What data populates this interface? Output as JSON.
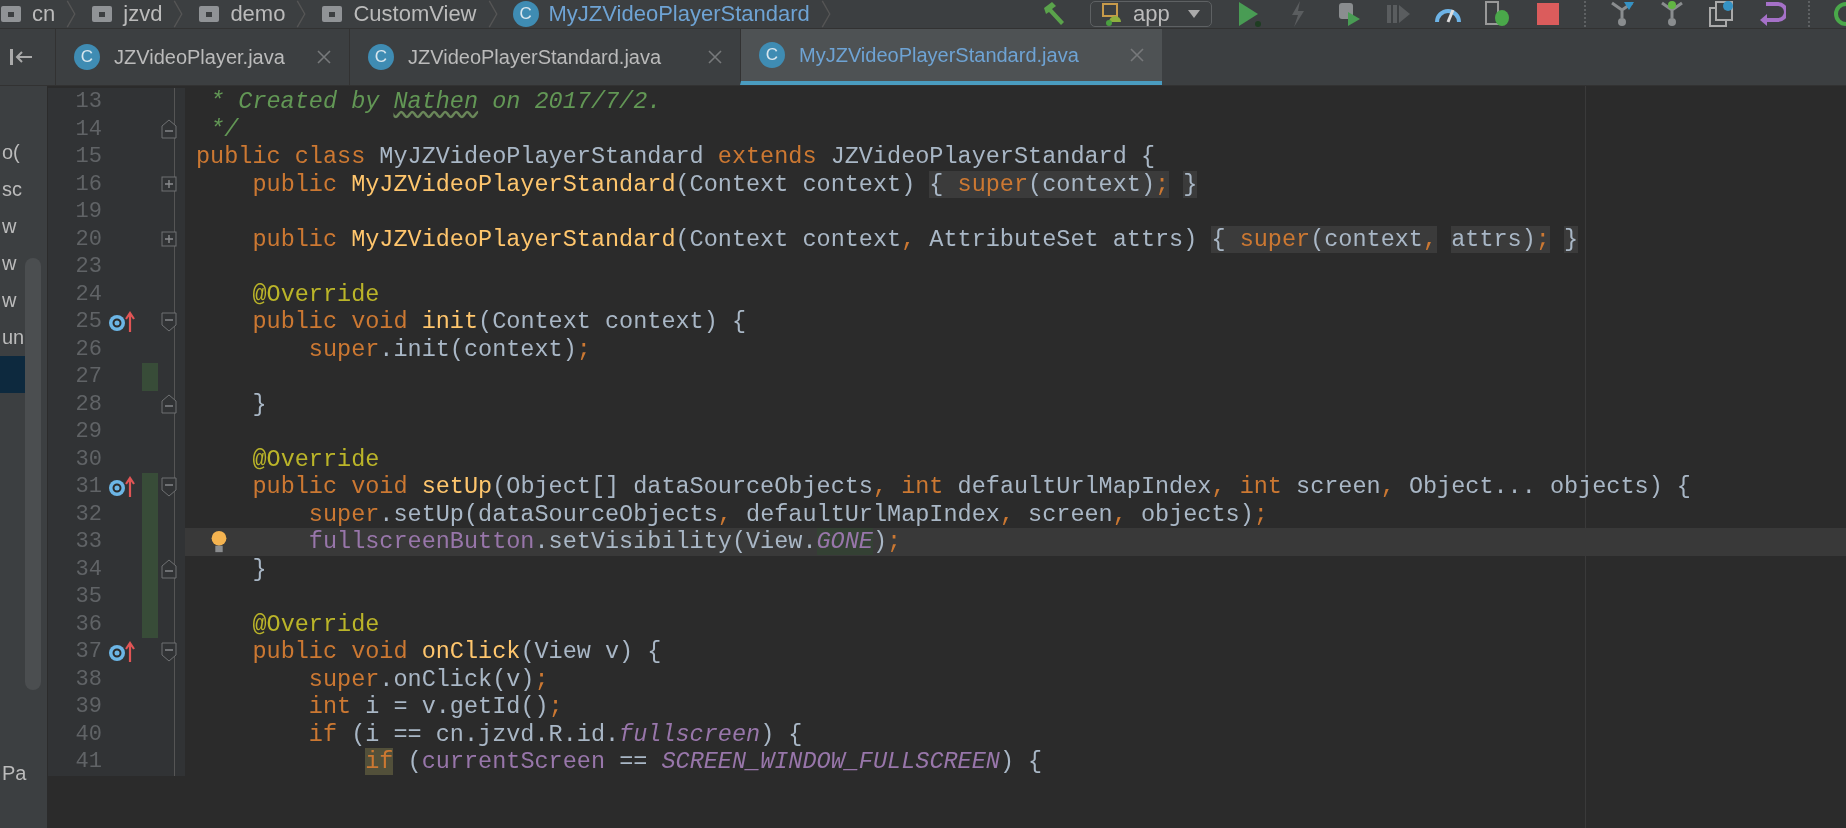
{
  "breadcrumb": [
    {
      "kind": "package",
      "label": "cn"
    },
    {
      "kind": "package",
      "label": "jzvd"
    },
    {
      "kind": "package",
      "label": "demo"
    },
    {
      "kind": "package",
      "label": "CustomView"
    },
    {
      "kind": "class",
      "icon_letter": "C",
      "label": "MyJZVideoPlayerStandard"
    }
  ],
  "toolbar": {
    "run_config": "app"
  },
  "tabs": [
    {
      "icon_letter": "C",
      "label": "JZVideoPlayer.java",
      "selected": false
    },
    {
      "icon_letter": "C",
      "label": "JZVideoPlayerStandard.java",
      "selected": false
    },
    {
      "icon_letter": "C",
      "label": "MyJZVideoPlayerStandard.java",
      "selected": true
    }
  ],
  "sidebar": {
    "items": [
      {
        "label": "o(",
        "selected": false
      },
      {
        "label": "sc",
        "selected": false
      },
      {
        "label": "w",
        "selected": false
      },
      {
        "label": "w",
        "selected": false
      },
      {
        "label": "w",
        "selected": false
      },
      {
        "label": "un",
        "selected": false
      },
      {
        "selected": true
      }
    ],
    "bottom_item": {
      "label": "Pa"
    }
  },
  "code_lines": [
    {
      "number": "13",
      "current": false,
      "tokens": [
        {
          "text": " * Created by ",
          "kind": "comment"
        },
        {
          "text": "Nathen",
          "kind": "comment_typo"
        },
        {
          "text": " on 2017/7/2.",
          "kind": "comment"
        }
      ]
    },
    {
      "number": "14",
      "current": false,
      "markers": [
        {
          "kind": "fold_end"
        }
      ],
      "tokens": [
        {
          "text": " */",
          "kind": "comment"
        }
      ]
    },
    {
      "number": "15",
      "current": false,
      "tokens": [
        {
          "text": "public class ",
          "kind": "keyword"
        },
        {
          "text": "MyJZVideoPlayerStandard ",
          "kind": "plain"
        },
        {
          "text": "extends ",
          "kind": "keyword"
        },
        {
          "text": "JZVideoPlayerStandard {",
          "kind": "plain"
        }
      ]
    },
    {
      "number": "16",
      "current": false,
      "markers": [
        {
          "kind": "fold_collapsed"
        }
      ],
      "tokens": [
        {
          "text": "    public ",
          "kind": "keyword"
        },
        {
          "text": "MyJZVideoPlayerStandard",
          "kind": "method"
        },
        {
          "text": "(Context context) ",
          "kind": "plain"
        },
        {
          "text": "{ ",
          "kind": "fold_plain"
        },
        {
          "text": "super",
          "kind": "fold_keyword"
        },
        {
          "text": "(context)",
          "kind": "fold_plain"
        },
        {
          "text": ";",
          "kind": "fold_punct"
        },
        {
          "text": " }",
          "kind": "fold_plain"
        }
      ]
    },
    {
      "number": "19",
      "current": false
    },
    {
      "number": "20",
      "current": false,
      "markers": [
        {
          "kind": "fold_collapsed"
        }
      ],
      "tokens": [
        {
          "text": "    public ",
          "kind": "keyword"
        },
        {
          "text": "MyJZVideoPlayerStandard",
          "kind": "method"
        },
        {
          "text": "(Context context",
          "kind": "plain"
        },
        {
          "text": ",",
          "kind": "punct"
        },
        {
          "text": " AttributeSet attrs) ",
          "kind": "plain"
        },
        {
          "text": "{ ",
          "kind": "fold_plain"
        },
        {
          "text": "super",
          "kind": "fold_keyword"
        },
        {
          "text": "(context",
          "kind": "fold_plain"
        },
        {
          "text": ",",
          "kind": "fold_punct"
        },
        {
          "text": " attrs)",
          "kind": "fold_plain"
        },
        {
          "text": ";",
          "kind": "fold_punct"
        },
        {
          "text": " }",
          "kind": "fold_plain"
        }
      ]
    },
    {
      "number": "23",
      "current": false
    },
    {
      "number": "24",
      "current": false,
      "tokens": [
        {
          "text": "    @Override",
          "kind": "annotation"
        }
      ]
    },
    {
      "number": "25",
      "current": false,
      "markers": [
        {
          "kind": "override"
        },
        {
          "kind": "fold_start"
        }
      ],
      "tokens": [
        {
          "text": "    public void ",
          "kind": "keyword"
        },
        {
          "text": "init",
          "kind": "method"
        },
        {
          "text": "(Context context) {",
          "kind": "plain"
        }
      ]
    },
    {
      "number": "26",
      "current": false,
      "tokens": [
        {
          "text": "        super",
          "kind": "keyword"
        },
        {
          "text": ".init(context)",
          "kind": "plain"
        },
        {
          "text": ";",
          "kind": "punct"
        }
      ]
    },
    {
      "number": "27",
      "current": false,
      "markers": [
        {
          "kind": "change"
        }
      ]
    },
    {
      "number": "28",
      "current": false,
      "markers": [
        {
          "kind": "fold_end"
        }
      ],
      "tokens": [
        {
          "text": "    }",
          "kind": "plain"
        }
      ]
    },
    {
      "number": "29",
      "current": false
    },
    {
      "number": "30",
      "current": false,
      "tokens": [
        {
          "text": "    @Override",
          "kind": "annotation"
        }
      ]
    },
    {
      "number": "31",
      "current": false,
      "markers": [
        {
          "kind": "override"
        },
        {
          "kind": "change"
        },
        {
          "kind": "fold_start"
        }
      ],
      "tokens": [
        {
          "text": "    public void ",
          "kind": "keyword"
        },
        {
          "text": "setUp",
          "kind": "method"
        },
        {
          "text": "(Object[] dataSourceObjects",
          "kind": "plain"
        },
        {
          "text": ",",
          "kind": "punct"
        },
        {
          "text": " int ",
          "kind": "keyword"
        },
        {
          "text": "defaultUrlMapIndex",
          "kind": "plain"
        },
        {
          "text": ",",
          "kind": "punct"
        },
        {
          "text": " int ",
          "kind": "keyword"
        },
        {
          "text": "screen",
          "kind": "plain"
        },
        {
          "text": ",",
          "kind": "punct"
        },
        {
          "text": " Object... objects) {",
          "kind": "plain"
        }
      ]
    },
    {
      "number": "32",
      "current": false,
      "markers": [
        {
          "kind": "change"
        }
      ],
      "tokens": [
        {
          "text": "        super",
          "kind": "keyword"
        },
        {
          "text": ".setUp(dataSourceObjects",
          "kind": "plain"
        },
        {
          "text": ",",
          "kind": "punct"
        },
        {
          "text": " defaultUrlMapIndex",
          "kind": "plain"
        },
        {
          "text": ",",
          "kind": "punct"
        },
        {
          "text": " screen",
          "kind": "plain"
        },
        {
          "text": ",",
          "kind": "punct"
        },
        {
          "text": " objects)",
          "kind": "plain"
        },
        {
          "text": ";",
          "kind": "punct"
        }
      ]
    },
    {
      "number": "33",
      "current": true,
      "markers": [
        {
          "kind": "change"
        },
        {
          "kind": "bulb"
        }
      ],
      "tokens": [
        {
          "text": "        fullscreenButton",
          "kind": "field"
        },
        {
          "text": ".setVisibility(View.",
          "kind": "plain"
        },
        {
          "text": "GONE",
          "kind": "static_hl"
        },
        {
          "text": ")",
          "kind": "plain"
        },
        {
          "text": ";",
          "kind": "punct"
        }
      ]
    },
    {
      "number": "34",
      "current": false,
      "markers": [
        {
          "kind": "change"
        },
        {
          "kind": "fold_end"
        }
      ],
      "tokens": [
        {
          "text": "    }",
          "kind": "plain"
        }
      ]
    },
    {
      "number": "35",
      "current": false,
      "markers": [
        {
          "kind": "change"
        }
      ]
    },
    {
      "number": "36",
      "current": false,
      "markers": [
        {
          "kind": "change"
        }
      ],
      "tokens": [
        {
          "text": "    @Override",
          "kind": "annotation"
        }
      ]
    },
    {
      "number": "37",
      "current": false,
      "markers": [
        {
          "kind": "override"
        },
        {
          "kind": "fold_start"
        }
      ],
      "tokens": [
        {
          "text": "    public void ",
          "kind": "keyword"
        },
        {
          "text": "onClick",
          "kind": "method"
        },
        {
          "text": "(View v) {",
          "kind": "plain"
        }
      ]
    },
    {
      "number": "38",
      "current": false,
      "tokens": [
        {
          "text": "        super",
          "kind": "keyword"
        },
        {
          "text": ".onClick(v)",
          "kind": "plain"
        },
        {
          "text": ";",
          "kind": "punct"
        }
      ]
    },
    {
      "number": "39",
      "current": false,
      "tokens": [
        {
          "text": "        int ",
          "kind": "keyword"
        },
        {
          "text": "i = v.getId()",
          "kind": "plain"
        },
        {
          "text": ";",
          "kind": "punct"
        }
      ]
    },
    {
      "number": "40",
      "current": false,
      "tokens": [
        {
          "text": "        if ",
          "kind": "keyword"
        },
        {
          "text": "(i == cn.jzvd.R.id.",
          "kind": "plain"
        },
        {
          "text": "fullscreen",
          "kind": "static"
        },
        {
          "text": ") {",
          "kind": "plain"
        }
      ]
    },
    {
      "number": "41",
      "current": false,
      "tokens": [
        {
          "text": "            if",
          "kind": "keyword_hl"
        },
        {
          "text": " (",
          "kind": "plain"
        },
        {
          "text": "currentScreen",
          "kind": "field"
        },
        {
          "text": " == ",
          "kind": "plain"
        },
        {
          "text": "SCREEN_WINDOW_FULLSCREEN",
          "kind": "static"
        },
        {
          "text": ") {",
          "kind": "plain"
        }
      ]
    }
  ]
}
